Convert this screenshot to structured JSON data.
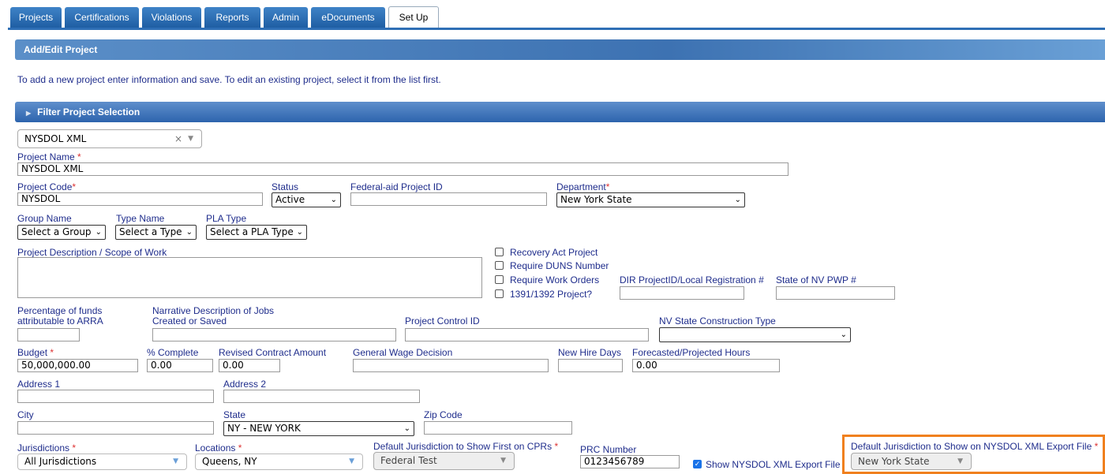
{
  "tabs": [
    "Projects",
    "Certifications",
    "Violations",
    "Reports",
    "Admin",
    "eDocuments",
    "Set Up"
  ],
  "header": {
    "title": "Add/Edit Project"
  },
  "intro": "To add a new project enter information and save. To edit an existing project, select it from the list first.",
  "filter": {
    "title": "Filter Project Selection",
    "selected": "NYSDOL XML",
    "clear": "×",
    "arrow": "▼"
  },
  "fields": {
    "project_name": {
      "label": "Project Name",
      "value": "NYSDOL XML"
    },
    "project_code": {
      "label": "Project Code",
      "value": "NYSDOL"
    },
    "status": {
      "label": "Status",
      "value": "Active"
    },
    "federal_id": {
      "label": "Federal-aid Project ID",
      "value": ""
    },
    "department": {
      "label": "Department",
      "value": "New York State"
    },
    "group_name": {
      "label": "Group Name",
      "value": "Select a Group"
    },
    "type_name": {
      "label": "Type Name",
      "value": "Select a Type"
    },
    "pla_type": {
      "label": "PLA Type",
      "value": "Select a PLA Type"
    },
    "description": {
      "label": "Project Description / Scope of Work"
    },
    "recovery": {
      "label": "Recovery Act Project"
    },
    "duns": {
      "label": "Require DUNS Number"
    },
    "work_orders": {
      "label": "Require Work Orders"
    },
    "p1391": {
      "label": "1391/1392 Project?"
    },
    "dir_id": {
      "label": "DIR ProjectID/Local Registration #"
    },
    "nv_pwp": {
      "label": "State of NV PWP #"
    },
    "arra_pct": {
      "label1": "Percentage of funds",
      "label2": "attributable to ARRA"
    },
    "narrative": {
      "label1": "Narrative Description of Jobs",
      "label2": "Created or Saved"
    },
    "control_id": {
      "label": "Project Control ID"
    },
    "nv_construction": {
      "label": "NV State Construction Type"
    },
    "budget": {
      "label": "Budget",
      "value": "50,000,000.00"
    },
    "pct_complete": {
      "label": "% Complete",
      "value": "0.00"
    },
    "revised_amount": {
      "label": "Revised Contract Amount",
      "value": "0.00"
    },
    "wage_decision": {
      "label": "General Wage Decision"
    },
    "new_hire_days": {
      "label": "New Hire Days"
    },
    "forecast_hours": {
      "label": "Forecasted/Projected Hours",
      "value": "0.00"
    },
    "address1": {
      "label": "Address 1"
    },
    "address2": {
      "label": "Address 2"
    },
    "city": {
      "label": "City"
    },
    "state": {
      "label": "State",
      "value": "NY - NEW YORK"
    },
    "zip": {
      "label": "Zip Code"
    },
    "jurisdictions": {
      "label": "Jurisdictions",
      "value": "All Jurisdictions"
    },
    "locations": {
      "label": "Locations",
      "value": "Queens, NY"
    },
    "default_cpr": {
      "label": "Default Jurisdiction to Show First on CPRs",
      "value": "Federal Test"
    },
    "prc": {
      "label": "PRC Number",
      "value": "0123456789"
    },
    "show_export": {
      "label": "Show NYSDOL XML Export File",
      "checked": true
    },
    "default_export": {
      "label": "Default Jurisdiction to Show on NYSDOL XML Export File",
      "value": "New York State"
    }
  },
  "required_mark": "*",
  "colors": {
    "accent": "#2f6fb5",
    "label": "#1f2d8c",
    "required": "#d33333",
    "highlight": "#f0801e"
  }
}
